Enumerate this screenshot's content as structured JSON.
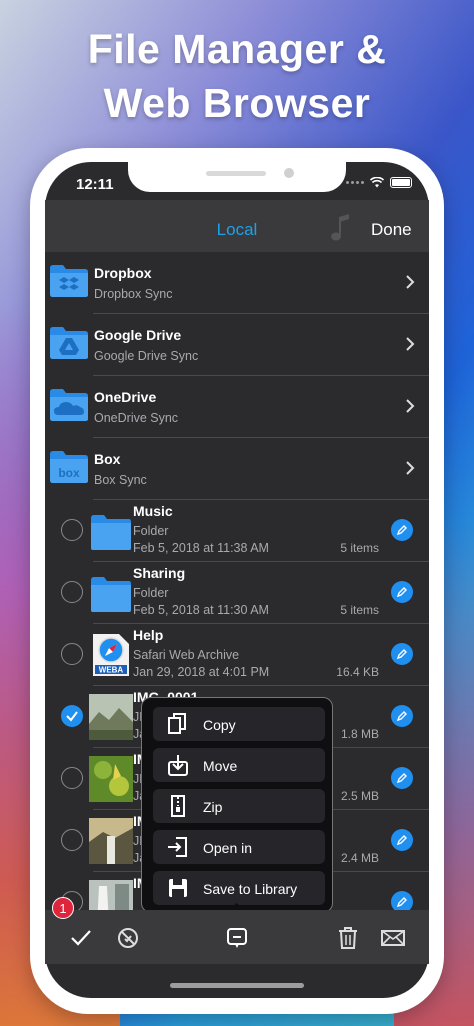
{
  "promo": {
    "line1": "File Manager &",
    "line2": "Web Browser"
  },
  "status": {
    "time": "12:11"
  },
  "navbar": {
    "title": "Local",
    "done_label": "Done"
  },
  "cloud_services": [
    {
      "name": "Dropbox",
      "subtitle": "Dropbox Sync",
      "icon": "dropbox-icon"
    },
    {
      "name": "Google Drive",
      "subtitle": "Google Drive Sync",
      "icon": "google-drive-icon"
    },
    {
      "name": "OneDrive",
      "subtitle": "OneDrive Sync",
      "icon": "onedrive-icon"
    },
    {
      "name": "Box",
      "subtitle": "Box Sync",
      "icon": "box-icon"
    }
  ],
  "files": [
    {
      "name": "Music",
      "type": "Folder",
      "date": "Feb 5, 2018 at 11:38 AM",
      "size": "5 items",
      "selected": false
    },
    {
      "name": "Sharing",
      "type": "Folder",
      "date": "Feb 5, 2018 at 11:30 AM",
      "size": "5 items",
      "selected": false
    },
    {
      "name": "Help",
      "type": "Safari Web Archive",
      "date": "Jan 29, 2018 at 4:01 PM",
      "size": "16.4 KB",
      "thumb_label": "WEBA",
      "selected": false
    },
    {
      "name": "IMG_0001",
      "type": "JPEG",
      "date": "Jan",
      "size": "1.8 MB",
      "selected": true
    },
    {
      "name": "IMG_",
      "type": "JPEG",
      "date": "Jan",
      "size": "2.5 MB",
      "selected": false
    },
    {
      "name": "IMG_",
      "type": "JPEG",
      "date": "Jan",
      "size": "2.4 MB",
      "selected": false
    },
    {
      "name": "IMG_",
      "type": "",
      "date": "",
      "size": "",
      "selected": false
    }
  ],
  "context_menu": [
    {
      "label": "Copy",
      "icon": "copy-icon"
    },
    {
      "label": "Move",
      "icon": "move-icon"
    },
    {
      "label": "Zip",
      "icon": "zip-icon"
    },
    {
      "label": "Open in",
      "icon": "open-in-icon"
    },
    {
      "label": "Save to Library",
      "icon": "save-icon"
    }
  ],
  "toolbar": {
    "badge_count": "1"
  },
  "colors": {
    "accent": "#1f8ff0",
    "title_blue": "#1ea0e8",
    "badge_red": "#e0243c",
    "background": "#2b2b2e"
  }
}
